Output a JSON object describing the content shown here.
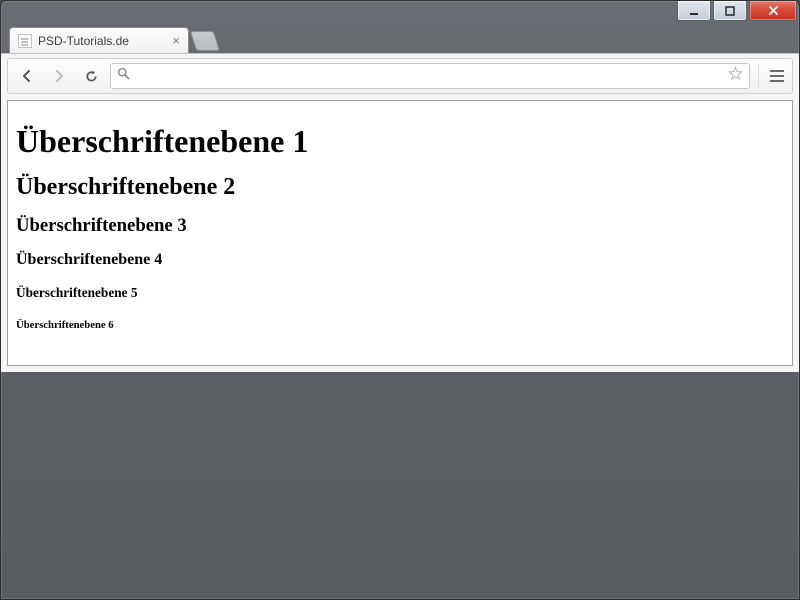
{
  "window": {
    "tab_title": "PSD-Tutorials.de",
    "address_value": ""
  },
  "page": {
    "h1": "Überschriftenebene 1",
    "h2": "Überschriftenebene 2",
    "h3": "Überschriftenebene 3",
    "h4": "Überschriftenebene 4",
    "h5": "Überschriftenebene 5",
    "h6": "Überschriftenebene 6"
  }
}
